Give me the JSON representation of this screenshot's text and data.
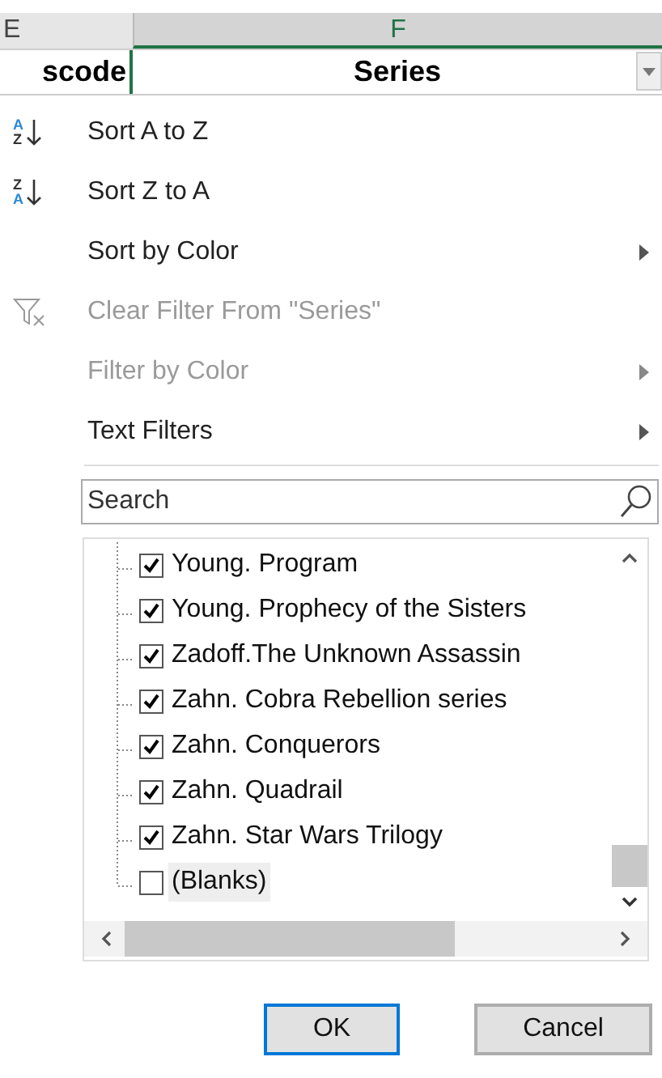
{
  "sheet": {
    "columns": [
      {
        "letter": "E",
        "selected": false
      },
      {
        "letter": "F",
        "selected": true
      }
    ],
    "headers": [
      {
        "text": "scode"
      },
      {
        "text": "Series"
      }
    ]
  },
  "menu": [
    {
      "label": "Sort A to Z",
      "kind": "sort-asc",
      "icon_letters": [
        "A",
        "Z"
      ],
      "disabled": false,
      "submenu": false
    },
    {
      "label": "Sort Z to A",
      "kind": "sort-desc",
      "icon_letters": [
        "Z",
        "A"
      ],
      "disabled": false,
      "submenu": false
    },
    {
      "label": "Sort by Color",
      "kind": "plain",
      "disabled": false,
      "submenu": true
    },
    {
      "label": "Clear Filter From \"Series\"",
      "kind": "clear",
      "disabled": true,
      "submenu": false
    },
    {
      "label": "Filter by Color",
      "kind": "plain",
      "disabled": true,
      "submenu": true
    },
    {
      "label": "Text Filters",
      "kind": "plain",
      "disabled": false,
      "submenu": true
    }
  ],
  "search": {
    "placeholder": "Search"
  },
  "values": [
    {
      "label": "Young. Program",
      "checked": true,
      "selected": false
    },
    {
      "label": "Young. Prophecy of the Sisters",
      "checked": true,
      "selected": false
    },
    {
      "label": "Zadoff.The Unknown Assassin",
      "checked": true,
      "selected": false
    },
    {
      "label": "Zahn. Cobra Rebellion series",
      "checked": true,
      "selected": false
    },
    {
      "label": "Zahn. Conquerors",
      "checked": true,
      "selected": false
    },
    {
      "label": "Zahn. Quadrail",
      "checked": true,
      "selected": false
    },
    {
      "label": "Zahn. Star Wars Trilogy",
      "checked": true,
      "selected": false
    },
    {
      "label": "(Blanks)",
      "checked": false,
      "selected": true
    }
  ],
  "buttons": [
    {
      "label": "OK",
      "default": true
    },
    {
      "label": "Cancel",
      "default": false
    }
  ]
}
